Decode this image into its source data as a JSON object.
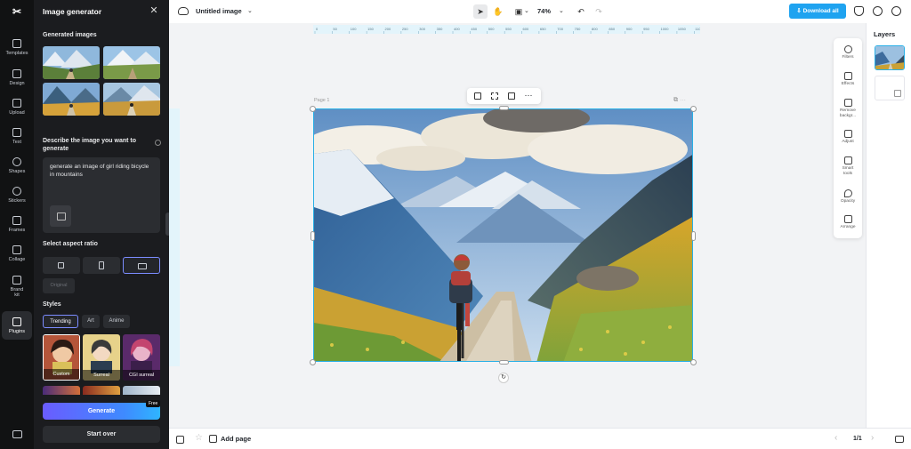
{
  "rail": {
    "items": [
      {
        "label": "Templates",
        "icon": "templates-icon"
      },
      {
        "label": "Design",
        "icon": "design-icon"
      },
      {
        "label": "Upload",
        "icon": "upload-icon"
      },
      {
        "label": "Text",
        "icon": "text-icon"
      },
      {
        "label": "Shapes",
        "icon": "shapes-icon"
      },
      {
        "label": "Stickers",
        "icon": "stickers-icon"
      },
      {
        "label": "Frames",
        "icon": "frames-icon"
      },
      {
        "label": "Collage",
        "icon": "collage-icon"
      },
      {
        "label": "Brand kit",
        "icon": "brand-kit-icon"
      },
      {
        "label": "Plugins",
        "icon": "plugins-icon"
      }
    ]
  },
  "panel": {
    "title": "Image generator",
    "generated_label": "Generated images",
    "describe_label": "Describe the image you want to generate",
    "prompt": "generate an image of girl riding bicycle in mountains",
    "aspect_label": "Select aspect ratio",
    "original_label": "Original",
    "styles_label": "Styles",
    "style_tabs": [
      "Trending",
      "Art",
      "Anime"
    ],
    "style_cards": [
      "Custom",
      "Surreal",
      "CGI surreal"
    ],
    "generate_label": "Generate",
    "free_badge": "Free",
    "start_over_label": "Start over"
  },
  "topbar": {
    "doc_title": "Untitled image",
    "zoom": "74%",
    "download_label": "Download all"
  },
  "canvas": {
    "page_label": "Page 1",
    "ruler_ticks": [
      "0",
      "50",
      "100",
      "150",
      "200",
      "250",
      "300",
      "350",
      "400",
      "450",
      "500",
      "550",
      "600",
      "650",
      "700",
      "750",
      "800",
      "850",
      "900",
      "950",
      "1000",
      "1050",
      "1100"
    ]
  },
  "side_tools": [
    {
      "label": "Filters",
      "icon": "filters-icon"
    },
    {
      "label": "Effects",
      "icon": "effects-icon"
    },
    {
      "label": "Remove backgr...",
      "icon": "remove-background-icon"
    },
    {
      "label": "Adjust",
      "icon": "adjust-icon"
    },
    {
      "label": "Smart tools",
      "icon": "smart-tools-icon"
    },
    {
      "label": "Opacity",
      "icon": "opacity-icon"
    },
    {
      "label": "Arrange",
      "icon": "arrange-icon"
    }
  ],
  "layers": {
    "title": "Layers"
  },
  "bottombar": {
    "add_page": "Add page",
    "page_count": "1/1"
  },
  "colors": {
    "accent": "#1fa3f0",
    "selection": "#2ab0e6",
    "panel_bg": "#1b1c1f",
    "rail_bg": "#111213"
  }
}
